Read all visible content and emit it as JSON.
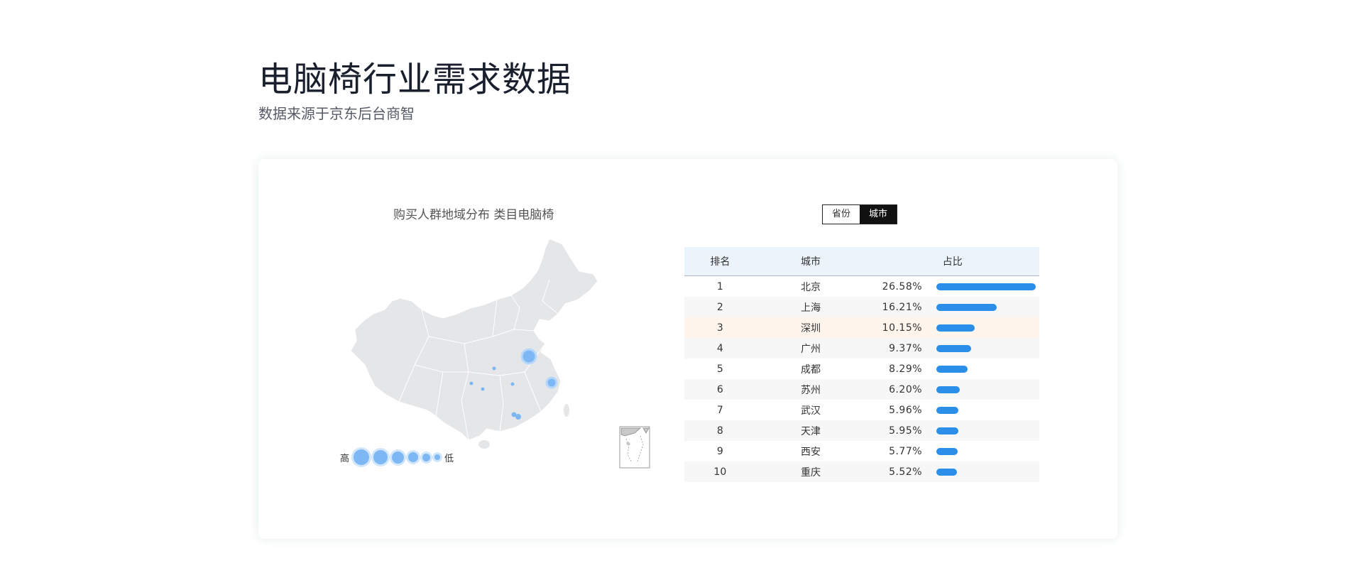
{
  "page": {
    "title": "电脑椅行业需求数据",
    "subtitle": "数据来源于京东后台商智"
  },
  "map": {
    "title": "购买人群地域分布 类目电脑椅",
    "legend": {
      "high": "高",
      "low": "低"
    },
    "bubble_color": "#7db8f5",
    "land_color": "#e5e6e8"
  },
  "toggle": {
    "province_label": "省份",
    "city_label": "城市",
    "selected": "城市"
  },
  "table": {
    "headers": {
      "rank": "排名",
      "city": "城市",
      "share": "占比"
    },
    "bar_color": "#2b8ee8",
    "highlight_row": 3,
    "rows": [
      {
        "rank": "1",
        "city": "北京",
        "pct": "26.58%",
        "value": 26.58
      },
      {
        "rank": "2",
        "city": "上海",
        "pct": "16.21%",
        "value": 16.21
      },
      {
        "rank": "3",
        "city": "深圳",
        "pct": "10.15%",
        "value": 10.15
      },
      {
        "rank": "4",
        "city": "广州",
        "pct": "9.37%",
        "value": 9.37
      },
      {
        "rank": "5",
        "city": "成都",
        "pct": "8.29%",
        "value": 8.29
      },
      {
        "rank": "6",
        "city": "苏州",
        "pct": "6.20%",
        "value": 6.2
      },
      {
        "rank": "7",
        "city": "武汉",
        "pct": "5.96%",
        "value": 5.96
      },
      {
        "rank": "8",
        "city": "天津",
        "pct": "5.95%",
        "value": 5.95
      },
      {
        "rank": "9",
        "city": "西安",
        "pct": "5.77%",
        "value": 5.77
      },
      {
        "rank": "10",
        "city": "重庆",
        "pct": "5.52%",
        "value": 5.52
      }
    ]
  }
}
